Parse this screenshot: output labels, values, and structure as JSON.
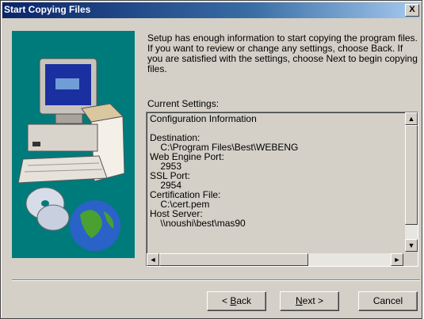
{
  "window": {
    "title": "Start Copying Files",
    "close_glyph": "X"
  },
  "intro": "Setup has enough information to start copying the program files. If you want to review or change any settings, choose Back.  If you are satisfied with the settings, choose Next to begin copying files.",
  "settings": {
    "label": "Current Settings:",
    "lines": [
      "Configuration Information",
      "",
      "Destination:",
      "    C:\\Program Files\\Best\\WEBENG",
      "Web Engine Port:",
      "    2953",
      "SSL Port:",
      "    2954",
      "Certification File:",
      "    C:\\cert.pem",
      "Host Server:",
      "    \\\\noushi\\best\\mas90"
    ]
  },
  "buttons": {
    "back": {
      "accel": "B",
      "rest": "ack",
      "prefix": "< "
    },
    "next": {
      "accel": "N",
      "rest": "ext >"
    },
    "cancel": "Cancel"
  },
  "icons": {
    "art": "computer-globe-cd-illustration",
    "scroll_up": "▲",
    "scroll_down": "▼",
    "scroll_left": "◄",
    "scroll_right": "►"
  }
}
